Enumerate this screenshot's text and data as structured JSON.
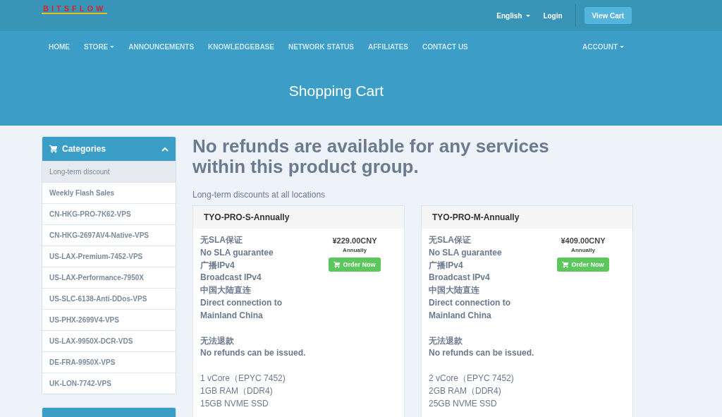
{
  "logo": {
    "text": "BITSFLOW"
  },
  "top_links": [
    {
      "label": "English",
      "dropdown": true
    },
    {
      "label": "Login",
      "dropdown": false
    }
  ],
  "view_cart_button": "View Cart",
  "nav": [
    {
      "label": "HOME",
      "dropdown": false
    },
    {
      "label": "STORE",
      "dropdown": true
    },
    {
      "label": "ANNOUNCEMENTS",
      "dropdown": false
    },
    {
      "label": "KNOWLEDGEBASE",
      "dropdown": false
    },
    {
      "label": "NETWORK STATUS",
      "dropdown": false
    },
    {
      "label": "AFFILIATES",
      "dropdown": false
    },
    {
      "label": "CONTACT US",
      "dropdown": false
    }
  ],
  "account_menu": {
    "label": "ACCOUNT",
    "dropdown": true
  },
  "page_title": "Shopping Cart",
  "sidebar": {
    "title": "Categories",
    "items": [
      {
        "label": "Long-term discount",
        "selected": true
      },
      {
        "label": "Weekly Flash Sales",
        "selected": false
      },
      {
        "label": "CN-HKG-PRO-7K62-VPS",
        "selected": false
      },
      {
        "label": "CN-HKG-2697AV4-Native-VPS",
        "selected": false
      },
      {
        "label": "US-LAX-Premium-7452-VPS",
        "selected": false
      },
      {
        "label": "US-LAX-Performance-7950X",
        "selected": false
      },
      {
        "label": "US-SLC-6138-Anti-DDos-VPS",
        "selected": false
      },
      {
        "label": "US-PHX-2699V4-VPS",
        "selected": false
      },
      {
        "label": "US-LAX-9950X-DCR-VDS",
        "selected": false
      },
      {
        "label": "DE-FRA-9950X-VPS",
        "selected": false
      },
      {
        "label": "UK-LON-7742-VPS",
        "selected": false
      }
    ]
  },
  "headline": "No refunds are available for any services within this product group.",
  "subtitle": "Long-term discounts at all locations",
  "products": [
    {
      "name": "TYO-PRO-S-Annually",
      "price": "¥229.00CNY",
      "cycle": "Annually",
      "button": "Order Now",
      "features": [
        [
          "无SLA保证",
          "No SLA guarantee",
          "广播IPv4",
          "Broadcast IPv4",
          "中国大陆直连",
          "Direct connection to",
          "Mainland China"
        ],
        [
          "无法退款",
          "No refunds can be issued."
        ]
      ],
      "specs": [
        "1 vCore（EPYC 7452)",
        "1GB RAM（DDR4)",
        "15GB NVME SSD"
      ]
    },
    {
      "name": "TYO-PRO-M-Annually",
      "price": "¥409.00CNY",
      "cycle": "Annually",
      "button": "Order Now",
      "features": [
        [
          "无SLA保证",
          "No SLA guarantee",
          "广播IPv4",
          "Broadcast IPv4",
          "中国大陆直连",
          "Direct connection to",
          "Mainland China"
        ],
        [
          "无法退款",
          "No refunds can be issued."
        ]
      ],
      "specs": [
        "2 vCore（EPYC 7452)",
        "2GB RAM（DDR4)",
        "25GB NVME SSD"
      ]
    }
  ]
}
